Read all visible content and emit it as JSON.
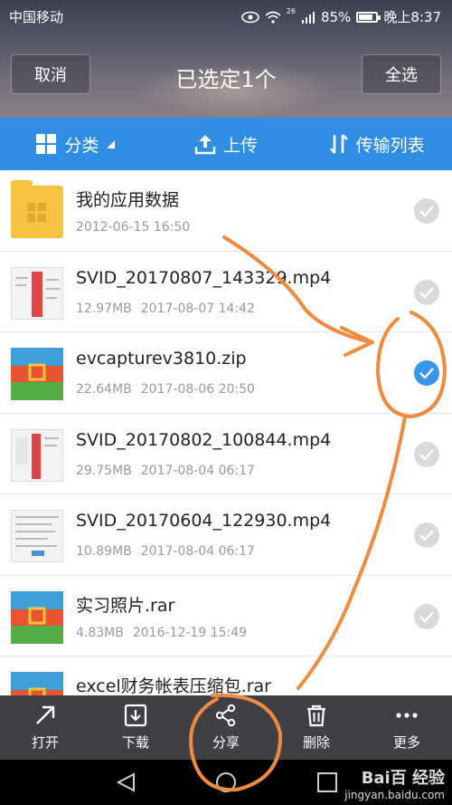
{
  "status": {
    "carrier": "中国移动",
    "network": "26",
    "battery": "85%",
    "time": "晚上8:37"
  },
  "header": {
    "cancel": "取消",
    "title": "已选定1个",
    "select_all": "全选"
  },
  "toolbar": {
    "category": "分类",
    "upload": "上传",
    "transfer": "传输列表"
  },
  "files": [
    {
      "name": "我的应用数据",
      "size": "",
      "date": "2012-06-15 16:50",
      "type": "folder",
      "checked": false
    },
    {
      "name": "SVID_20170807_143329.mp4",
      "size": "12.97MB",
      "date": "2017-08-07 14:42",
      "type": "video",
      "checked": false
    },
    {
      "name": "evcapturev3810.zip",
      "size": "22.64MB",
      "date": "2017-08-06 20:50",
      "type": "archive",
      "checked": true
    },
    {
      "name": "SVID_20170802_100844.mp4",
      "size": "29.75MB",
      "date": "2017-08-04 06:17",
      "type": "video",
      "checked": false
    },
    {
      "name": "SVID_20170604_122930.mp4",
      "size": "10.89MB",
      "date": "2017-08-04 06:17",
      "type": "video",
      "checked": false
    },
    {
      "name": "实习照片.rar",
      "size": "4.83MB",
      "date": "2016-12-19 15:49",
      "type": "archive",
      "checked": false
    },
    {
      "name": "excel财务帐表压缩包.rar",
      "size": "",
      "date": "",
      "type": "archive",
      "checked": false
    }
  ],
  "actions": {
    "open": "打开",
    "download": "下载",
    "share": "分享",
    "delete": "删除",
    "more": "更多"
  },
  "watermark": {
    "brand": "Bai百 经验",
    "site": "jingyan.baidu.com"
  },
  "colors": {
    "accent": "#2f8de4",
    "annotation": "#f08a3c",
    "action_bar": "#3f3f46"
  }
}
